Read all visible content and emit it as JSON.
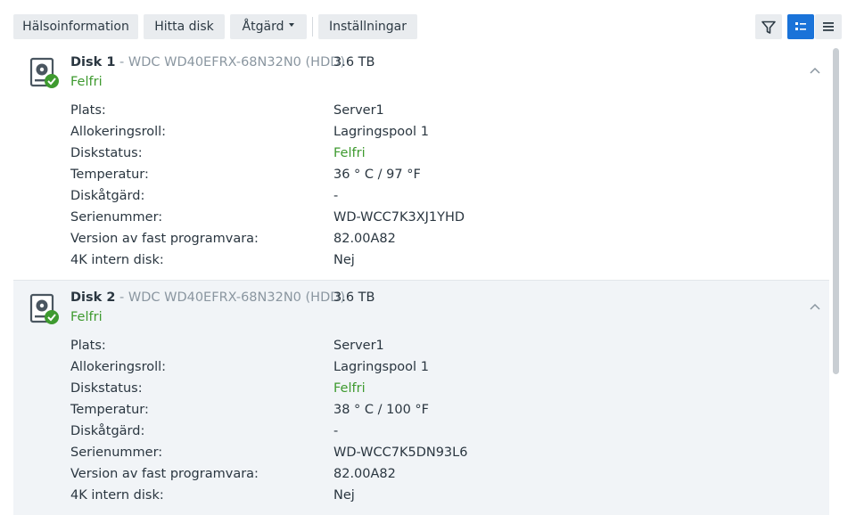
{
  "toolbar": {
    "health_label": "Hälsoinformation",
    "find_label": "Hitta disk",
    "action_label": "Åtgärd",
    "settings_label": "Inställningar",
    "icons": [
      "filter-icon",
      "list-detail-view-icon",
      "list-compact-view-icon"
    ]
  },
  "colors": {
    "accent": "#1a73d9",
    "healthy": "#3e9a2f",
    "button_bg": "#e9ecef",
    "selected_row_bg": "#f1f4f7"
  },
  "disks": [
    {
      "name": "Disk 1",
      "model": " - WDC WD40EFRX-68N32N0 (HDD)",
      "size": "3.6 TB",
      "status": "Felfri",
      "details": [
        {
          "label": "Plats:",
          "value": "Server1"
        },
        {
          "label": "Allokeringsroll:",
          "value": "Lagringspool 1"
        },
        {
          "label": "Diskstatus:",
          "value": "Felfri"
        },
        {
          "label": "Temperatur:",
          "value": "36 ° C / 97 °F"
        },
        {
          "label": "Diskåtgärd:",
          "value": "-"
        },
        {
          "label": "Serienummer:",
          "value": "WD-WCC7K3XJ1YHD"
        },
        {
          "label": "Version av fast programvara:",
          "value": "82.00A82"
        },
        {
          "label": "4K intern disk:",
          "value": "Nej"
        }
      ]
    },
    {
      "name": "Disk 2",
      "model": " - WDC WD40EFRX-68N32N0 (HDD)",
      "size": "3.6 TB",
      "status": "Felfri",
      "details": [
        {
          "label": "Plats:",
          "value": "Server1"
        },
        {
          "label": "Allokeringsroll:",
          "value": "Lagringspool 1"
        },
        {
          "label": "Diskstatus:",
          "value": "Felfri"
        },
        {
          "label": "Temperatur:",
          "value": "38 ° C / 100 °F"
        },
        {
          "label": "Diskåtgärd:",
          "value": "-"
        },
        {
          "label": "Serienummer:",
          "value": "WD-WCC7K5DN93L6"
        },
        {
          "label": "Version av fast programvara:",
          "value": "82.00A82"
        },
        {
          "label": "4K intern disk:",
          "value": "Nej"
        }
      ]
    }
  ]
}
